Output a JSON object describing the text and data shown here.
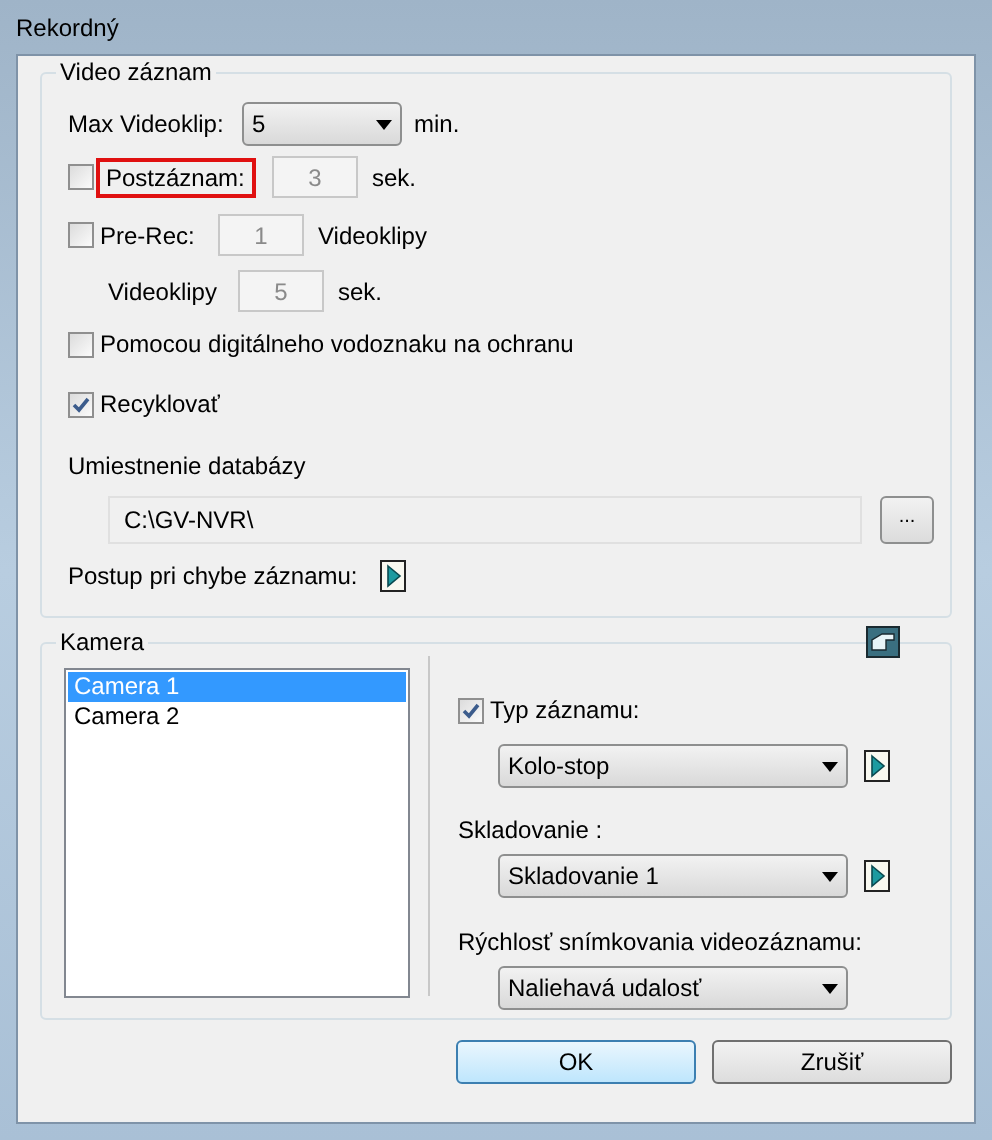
{
  "window": {
    "title": "Rekordný"
  },
  "video_group": {
    "title": "Video záznam",
    "max_clip": {
      "label": "Max Videoklip:",
      "value": "5",
      "unit": "min."
    },
    "post_record": {
      "label": "Postzáznam:",
      "checked": false,
      "highlighted": true,
      "value": "3",
      "disabled": true,
      "unit": "sek."
    },
    "pre_record": {
      "label": "Pre-Rec:",
      "checked": false,
      "value": "1",
      "disabled": true,
      "unit": "Videoklipy"
    },
    "pre_clip": {
      "label": "Videoklipy",
      "value": "5",
      "disabled": true,
      "unit": "sek."
    },
    "watermark": {
      "label": "Pomocou digitálneho vodoznaku na ochranu",
      "checked": false
    },
    "recycle": {
      "label": "Recyklovať",
      "checked": true
    },
    "db_location": {
      "label": "Umiestnenie databázy",
      "value": "C:\\GV-NVR\\",
      "browse": "..."
    },
    "error_action": {
      "label": "Postup pri chybe záznamu:"
    }
  },
  "camera_group": {
    "title": "Kamera",
    "cameras": [
      {
        "name": "Camera 1",
        "selected": true
      },
      {
        "name": "Camera 2",
        "selected": false
      }
    ],
    "record_type": {
      "label": "Typ záznamu:",
      "checked": true,
      "value": "Kolo-stop"
    },
    "storage": {
      "label": "Skladovanie :",
      "value": "Skladovanie 1"
    },
    "frame_rate": {
      "label": "Rýchlosť snímkovania videozáznamu:",
      "value": "Naliehavá udalosť"
    }
  },
  "buttons": [
    {
      "label": "OK",
      "default": true
    },
    {
      "label": "Zrušiť",
      "default": false
    }
  ]
}
